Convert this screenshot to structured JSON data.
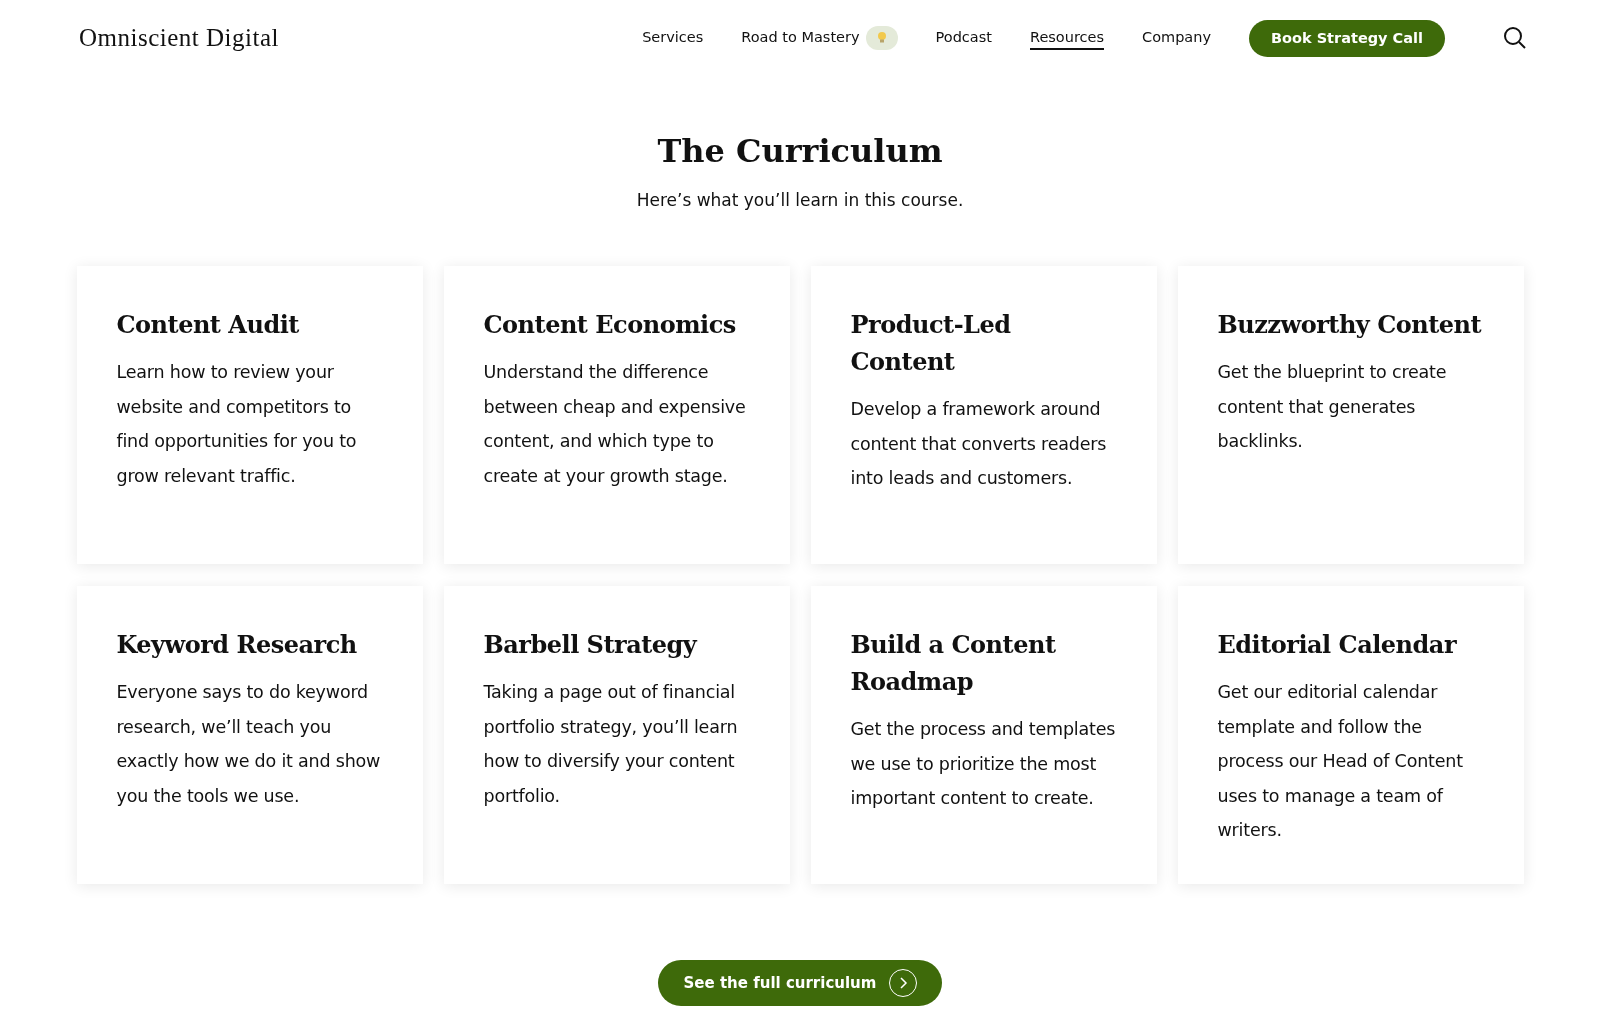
{
  "header": {
    "logo": "Omniscient Digital",
    "nav": [
      {
        "label": "Services",
        "selected": false,
        "badge": false
      },
      {
        "label": "Road to Mastery",
        "selected": false,
        "badge": true
      },
      {
        "label": "Podcast",
        "selected": false,
        "badge": false
      },
      {
        "label": "Resources",
        "selected": true,
        "badge": false
      },
      {
        "label": "Company",
        "selected": false,
        "badge": false
      }
    ],
    "cta": "Book Strategy Call"
  },
  "section": {
    "title": "The Curriculum",
    "subtitle": "Here’s what you’ll learn in this course.",
    "cards": [
      {
        "title": "Content Audit",
        "text": "Learn how to review your website and competitors to find opportunities for you to grow relevant traffic."
      },
      {
        "title": "Content Economics",
        "text": "Understand the difference between cheap and expensive content, and which type to create at your growth stage."
      },
      {
        "title": "Product-Led Content",
        "text": "Develop a framework around content that converts readers into leads and customers."
      },
      {
        "title": "Buzzworthy Content",
        "text": "Get the blueprint to create content that generates backlinks."
      },
      {
        "title": "Keyword Research",
        "text": "Everyone says to do keyword research, we’ll teach you exactly how we do it and show you the tools we use."
      },
      {
        "title": "Barbell Strategy",
        "text": "Taking a page out of financial portfolio strategy, you’ll learn how to diversify your content portfolio."
      },
      {
        "title": "Build a Content Roadmap",
        "text": "Get the process and templates we use to prioritize the most important content to create."
      },
      {
        "title": "Editorial Calendar",
        "text": "Get our editorial calendar template and follow the process our Head of Content uses to manage a team of writers."
      }
    ],
    "button": "See the full curriculum"
  }
}
